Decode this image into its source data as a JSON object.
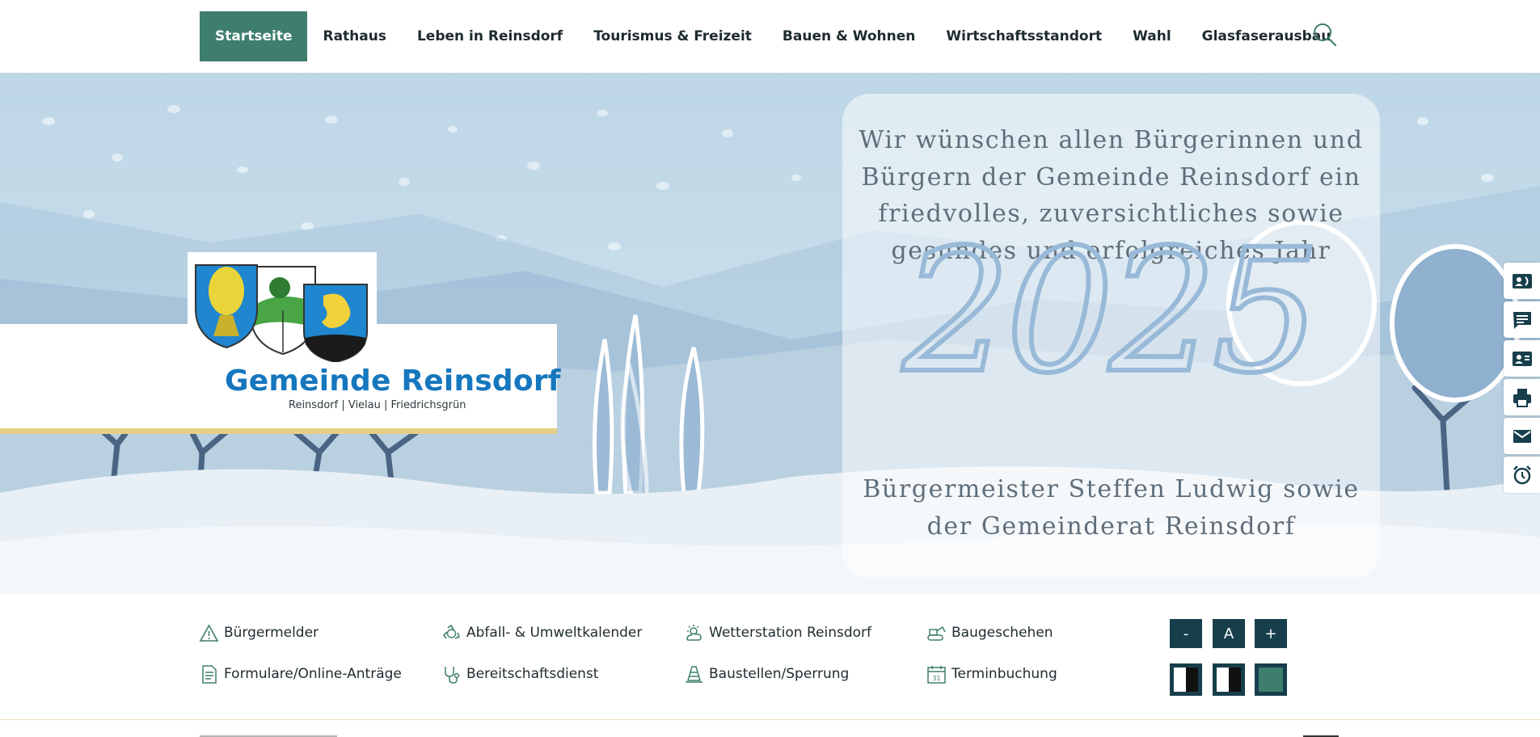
{
  "nav": {
    "items": [
      {
        "label": "Startseite",
        "active": true
      },
      {
        "label": "Rathaus"
      },
      {
        "label": "Leben in Reinsdorf"
      },
      {
        "label": "Tourismus & Freizeit"
      },
      {
        "label": "Bauen & Wohnen"
      },
      {
        "label": "Wirtschaftsstandort"
      },
      {
        "label": "Wahl"
      },
      {
        "label": "Glasfaserausbau"
      }
    ],
    "search_icon": "search-icon"
  },
  "hero": {
    "logo": {
      "name": "Gemeinde Reinsdorf",
      "subtitle": "Reinsdorf | Vielau | Friedrichsgrün"
    },
    "greeting": "Wir wünschen allen Bürgerinnen und Bürgern der Gemeinde Reinsdorf ein friedvolles, zuversichtliches sowie gesundes und erfolgreiches Jahr",
    "year": "2025",
    "signature": "Bürgermeister Steffen Ludwig sowie der Gemeinderat Reinsdorf"
  },
  "sidebar": {
    "buttons": [
      {
        "icon": "contact-card-phone-icon"
      },
      {
        "icon": "chat-icon"
      },
      {
        "icon": "contact-card-icon"
      },
      {
        "icon": "printer-icon"
      },
      {
        "icon": "mail-icon"
      },
      {
        "icon": "alarm-clock-icon"
      }
    ]
  },
  "quicklinks": {
    "items": [
      {
        "label": "Bürgermelder",
        "icon": "warning-icon"
      },
      {
        "label": "Abfall- & Umweltkalender",
        "icon": "recycle-icon"
      },
      {
        "label": "Wetterstation Reinsdorf",
        "icon": "weather-icon"
      },
      {
        "label": "Baugeschehen",
        "icon": "excavator-icon"
      },
      {
        "label": "Formulare/Online-Anträge",
        "icon": "document-icon"
      },
      {
        "label": "Bereitschaftsdienst",
        "icon": "stethoscope-icon"
      },
      {
        "label": "Baustellen/Sperrung",
        "icon": "traffic-cone-icon"
      },
      {
        "label": "Terminbuchung",
        "icon": "calendar-icon",
        "icon_text": "31"
      }
    ]
  },
  "accessibility": {
    "font_buttons": [
      "-",
      "A",
      "+"
    ],
    "contrast_modes": [
      "contrast-mode-1",
      "contrast-mode-2",
      "contrast-mode-3"
    ]
  },
  "colors": {
    "accent": "#3e7e6e",
    "nav_text": "#1e2b2f",
    "brand_blue": "#1577be",
    "gold": "#e6cf86",
    "dark_button": "#173f4b",
    "greeting_text": "#5f6e7a",
    "year_blue": "#98b9d7"
  }
}
